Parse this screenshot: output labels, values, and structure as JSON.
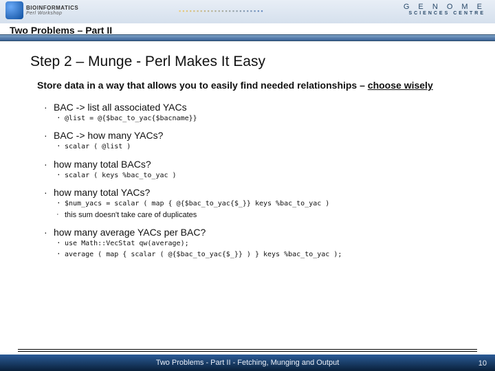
{
  "header": {
    "logo_left_top": "BIOINFORMATICS",
    "logo_left_sub": "Perl Workshop",
    "logo_right_main": "G E N O M E",
    "logo_right_sub": "SCIENCES CENTRE",
    "title": "Two Problems – Part II"
  },
  "main": {
    "title": "Step 2 – Munge - Perl Makes It Easy",
    "intro_pre": "Store data in a way that allows you to easily find needed relationships – ",
    "intro_ul": "choose wisely",
    "items": [
      {
        "head": "BAC -> list all associated YACs",
        "subs": [
          {
            "text": "@list = @{$bac_to_yac{$bacname}}",
            "type": "code"
          }
        ]
      },
      {
        "head": "BAC -> how many YACs?",
        "subs": [
          {
            "text": "scalar ( @list )",
            "type": "code"
          }
        ]
      },
      {
        "head": "how many total BACs?",
        "subs": [
          {
            "text": "scalar ( keys %bac_to_yac )",
            "type": "code"
          }
        ]
      },
      {
        "head": "how many total YACs?",
        "subs": [
          {
            "text": "$num_yacs = scalar ( map { @{$bac_to_yac{$_}} keys %bac_to_yac )",
            "type": "code"
          },
          {
            "text": "this sum doesn't take care of duplicates",
            "type": "plain"
          }
        ]
      },
      {
        "head": "how many average YACs per BAC?",
        "subs": [
          {
            "text": "use Math::VecStat qw(average);",
            "type": "code"
          },
          {
            "text": "average ( map { scalar ( @{$bac_to_yac{$_}} ) } keys %bac_to_yac );",
            "type": "code"
          }
        ]
      }
    ]
  },
  "footer": {
    "text": "Two Problems - Part II - Fetching, Munging and Output",
    "page": "10"
  }
}
